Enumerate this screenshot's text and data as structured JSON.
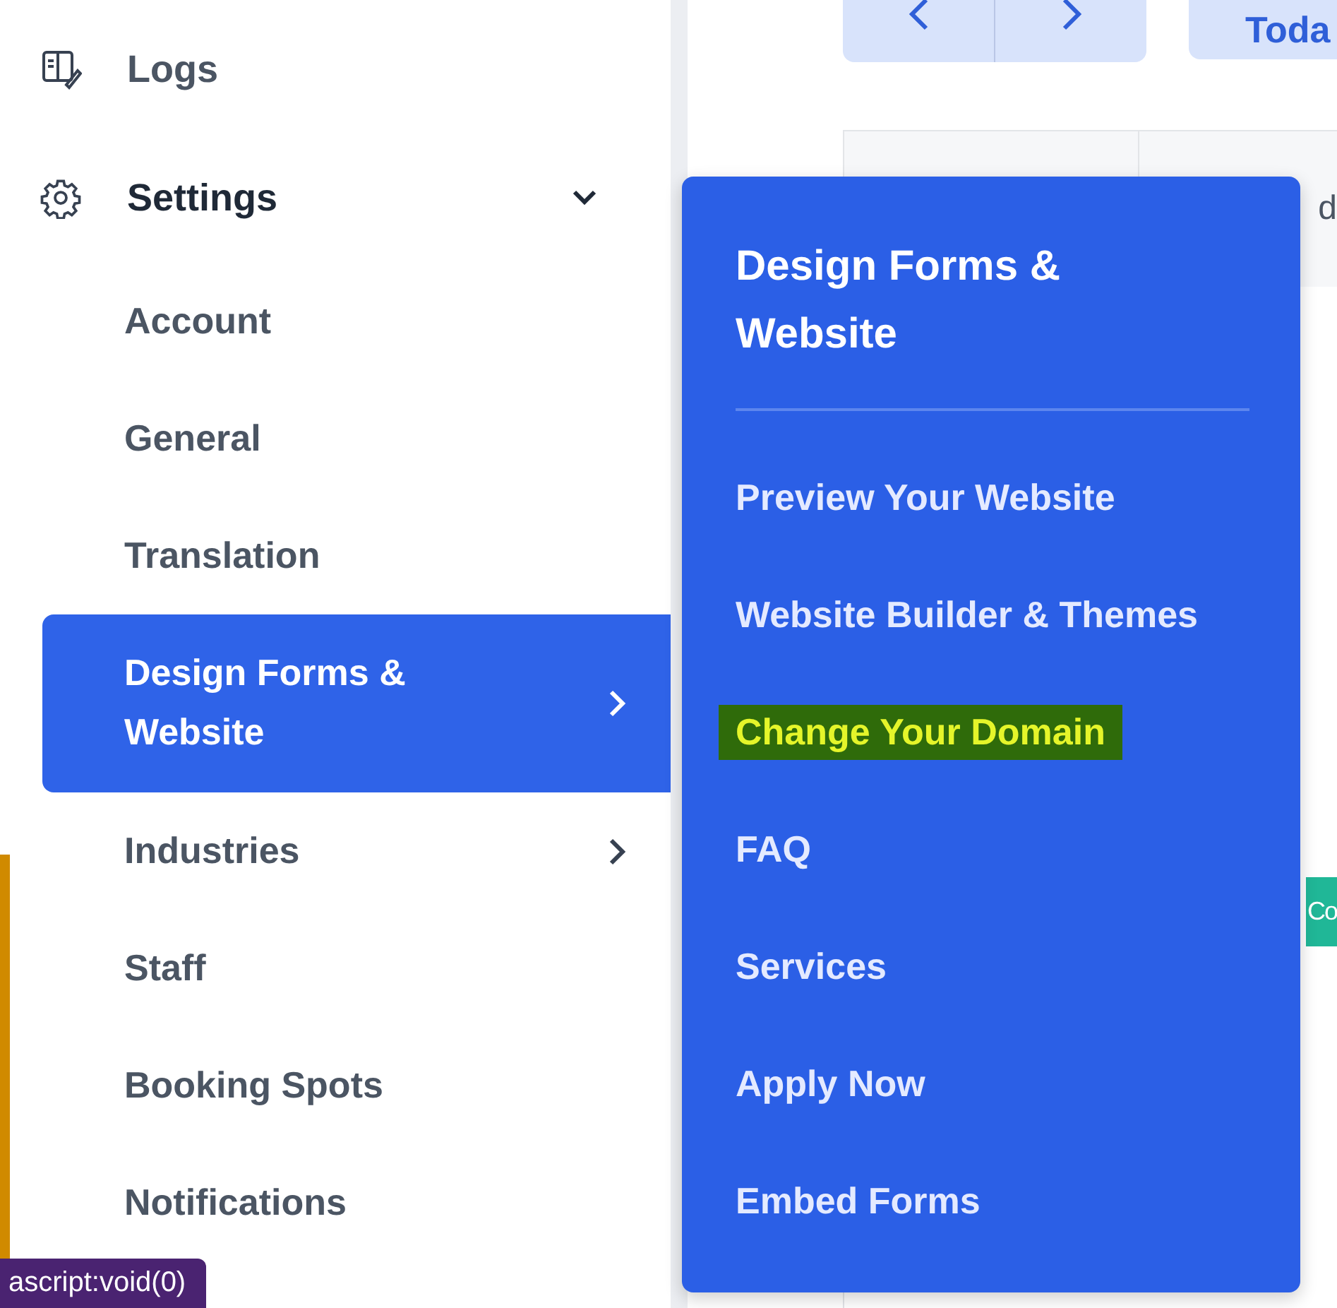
{
  "sidebar": {
    "items": [
      {
        "label": "Logs"
      },
      {
        "label": "Settings",
        "expanded": true,
        "children": [
          {
            "label": "Account",
            "selected": false,
            "has_submenu": false
          },
          {
            "label": "General",
            "selected": false,
            "has_submenu": false
          },
          {
            "label": "Translation",
            "selected": false,
            "has_submenu": false
          },
          {
            "label": "Design Forms & Website",
            "selected": true,
            "has_submenu": true
          },
          {
            "label": "Industries",
            "selected": false,
            "has_submenu": true
          },
          {
            "label": "Staff",
            "selected": false,
            "has_submenu": false
          },
          {
            "label": "Booking Spots",
            "selected": false,
            "has_submenu": false
          },
          {
            "label": "Notifications",
            "selected": false,
            "has_submenu": false
          }
        ]
      }
    ]
  },
  "calendar": {
    "today_button": "Toda",
    "column_header": "d",
    "badge": "Co"
  },
  "submenu": {
    "title": "Design Forms & Website",
    "items": [
      {
        "label": "Preview Your Website",
        "highlighted": false
      },
      {
        "label": "Website Builder & Themes",
        "highlighted": false
      },
      {
        "label": "Change Your Domain",
        "highlighted": true
      },
      {
        "label": "FAQ",
        "highlighted": false
      },
      {
        "label": "Services",
        "highlighted": false
      },
      {
        "label": "Apply Now",
        "highlighted": false
      },
      {
        "label": "Embed Forms",
        "highlighted": false
      }
    ]
  },
  "status_tooltip": "ascript:void(0)"
}
